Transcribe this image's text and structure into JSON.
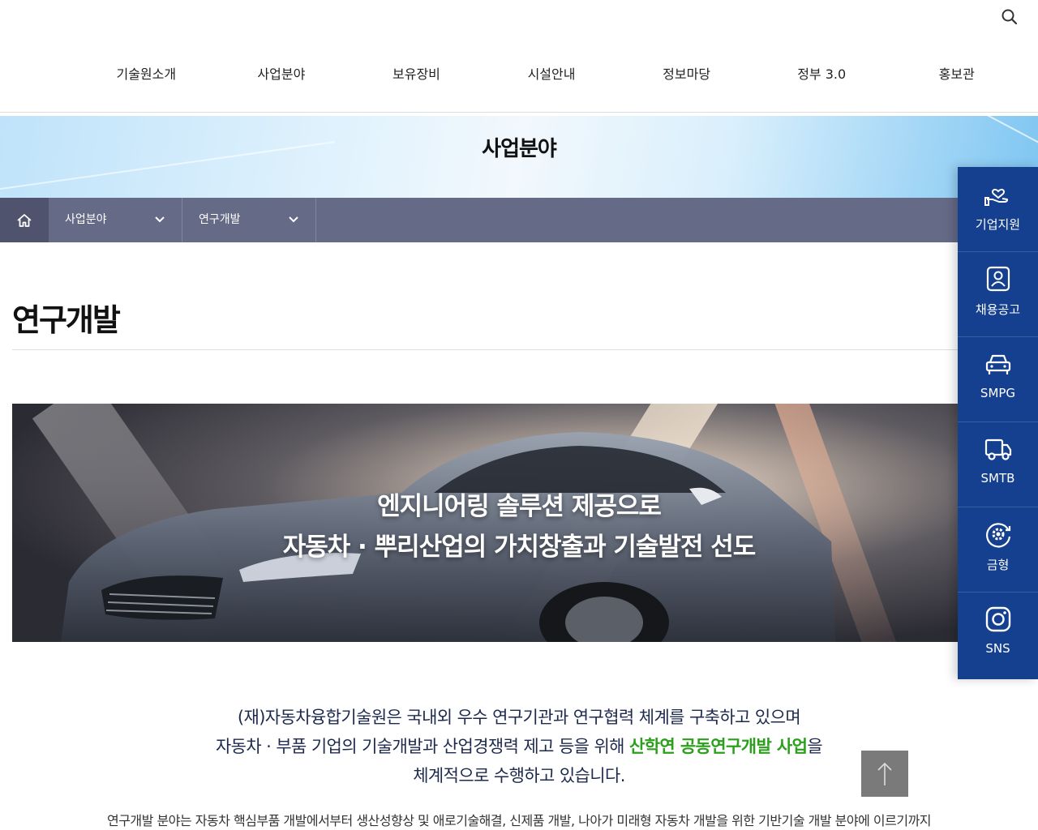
{
  "header": {
    "nav": [
      "기술원소개",
      "사업분야",
      "보유장비",
      "시설안내",
      "정보마당",
      "정부 3.0",
      "홍보관"
    ]
  },
  "subvisual": {
    "title": "사업분야"
  },
  "location": {
    "depth1": "사업분야",
    "depth2": "연구개발"
  },
  "page": {
    "title": "연구개발"
  },
  "banner": {
    "line1": "엔지니어링 솔루션 제공으로",
    "line2": "자동차 · 뿌리산업의 가치창출과 기술발전 선도"
  },
  "intro": {
    "line1": "(재)자동차융합기술원은 국내외 우수 연구기관과 연구협력 체계를 구축하고 있으며",
    "line2_pre": "자동차 · 부품 기업의 기술개발과 산업경쟁력 제고 등을 위해 ",
    "line2_highlight": "산학연 공동연구개발 사업",
    "line2_post": "을",
    "line3": "체계적으로 수행하고 있습니다."
  },
  "description": "연구개발 분야는 자동차 핵심부품 개발에서부터 생산성향상 및 애로기술해결, 신제품 개발, 나아가 미래형 자동차 개발을 위한 기반기술 개발 분야에 이르기까지",
  "quick_menu": [
    {
      "label": "기업지원",
      "icon": "hand-heart-icon"
    },
    {
      "label": "채용공고",
      "icon": "id-badge-icon"
    },
    {
      "label": "SMPG",
      "icon": "car-front-icon"
    },
    {
      "label": "SMTB",
      "icon": "truck-icon"
    },
    {
      "label": "금형",
      "icon": "gear-cycle-icon"
    },
    {
      "label": "SNS",
      "icon": "instagram-icon"
    }
  ],
  "colors": {
    "quick_menu_bg": "#15408f",
    "location_bar_bg": "#656a87",
    "highlight_green": "#2ca01c",
    "intro_text": "#1d2a4d"
  }
}
